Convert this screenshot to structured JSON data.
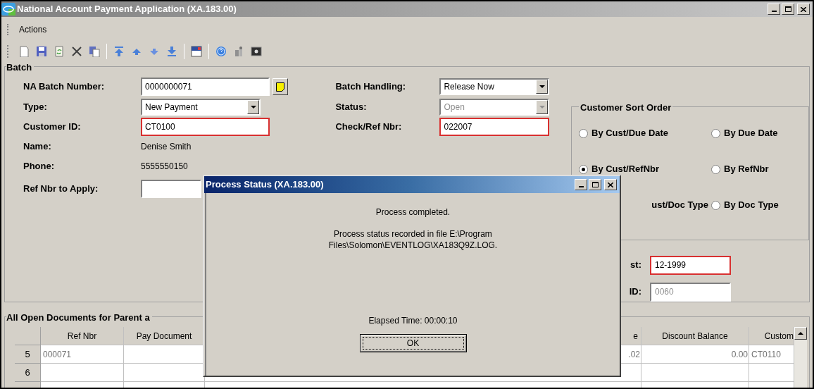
{
  "window": {
    "title": "National Account Payment Application (XA.183.00)"
  },
  "menu": [
    "Actions"
  ],
  "batch": {
    "title": "Batch",
    "left_fields": [
      {
        "label": "NA Batch Number:",
        "value": "0000000071",
        "kind": "lookup",
        "required": false
      },
      {
        "label": "Type:",
        "value": "New Payment",
        "kind": "dropdown"
      },
      {
        "label": "Customer ID:",
        "value": "CT0100",
        "kind": "text",
        "required": true
      },
      {
        "label": "Name:",
        "value": "Denise Smith",
        "kind": "display"
      },
      {
        "label": "Phone:",
        "value": "5555550150",
        "kind": "display"
      },
      {
        "label": "Ref Nbr to Apply:",
        "kind": "text",
        "required": false
      }
    ],
    "middle_fields": [
      {
        "label": "Batch Handling:",
        "value": "Release Now",
        "kind": "dropdown",
        "disabled": false
      },
      {
        "label": "Status:",
        "value": "Open",
        "kind": "dropdown",
        "disabled": true
      },
      {
        "label": "Check/Ref Nbr:",
        "value": "022007",
        "kind": "text",
        "required": true
      }
    ],
    "sort_order": {
      "title": "Customer Sort Order",
      "options": [
        {
          "label": "By Cust/Due Date",
          "kind": "radio",
          "selected": false
        },
        {
          "label": "By Due Date",
          "kind": "radio",
          "selected": false
        },
        {
          "label": "By Cust/RefNbr",
          "kind": "radio",
          "selected": true
        },
        {
          "label": "By RefNbr",
          "kind": "radio",
          "selected": false
        },
        {
          "label": "ust/Doc Type",
          "kind": "clipped"
        },
        {
          "label": "By Doc Type",
          "kind": "radio",
          "selected": false
        }
      ]
    },
    "right_fields": [
      {
        "label": "st:",
        "value": "12-1999",
        "required": true,
        "disabled": false
      },
      {
        "label": "ID:",
        "value": "0060",
        "required": false,
        "disabled": true
      }
    ]
  },
  "grid": {
    "title": "All Open Documents for Parent a",
    "columns": [
      "Ref Nbr",
      "Pay Document",
      "e",
      "Discount Balance",
      "Custom"
    ],
    "rows": [
      {
        "number": "5",
        "cells": [
          "000071",
          "",
          ".02",
          "0.00",
          "CT0110"
        ]
      },
      {
        "number": "6",
        "cells": [
          "",
          "",
          "",
          "",
          ""
        ]
      }
    ]
  },
  "dialog": {
    "title": "Process Status (XA.183.00)",
    "message": "Process completed.",
    "detail": "Process status recorded in file E:\\Program Files\\Solomon\\EVENTLOG\\XA183Q9Z.LOG.",
    "elapsed": "Elapsed Time: 00:00:10",
    "button": "OK"
  }
}
